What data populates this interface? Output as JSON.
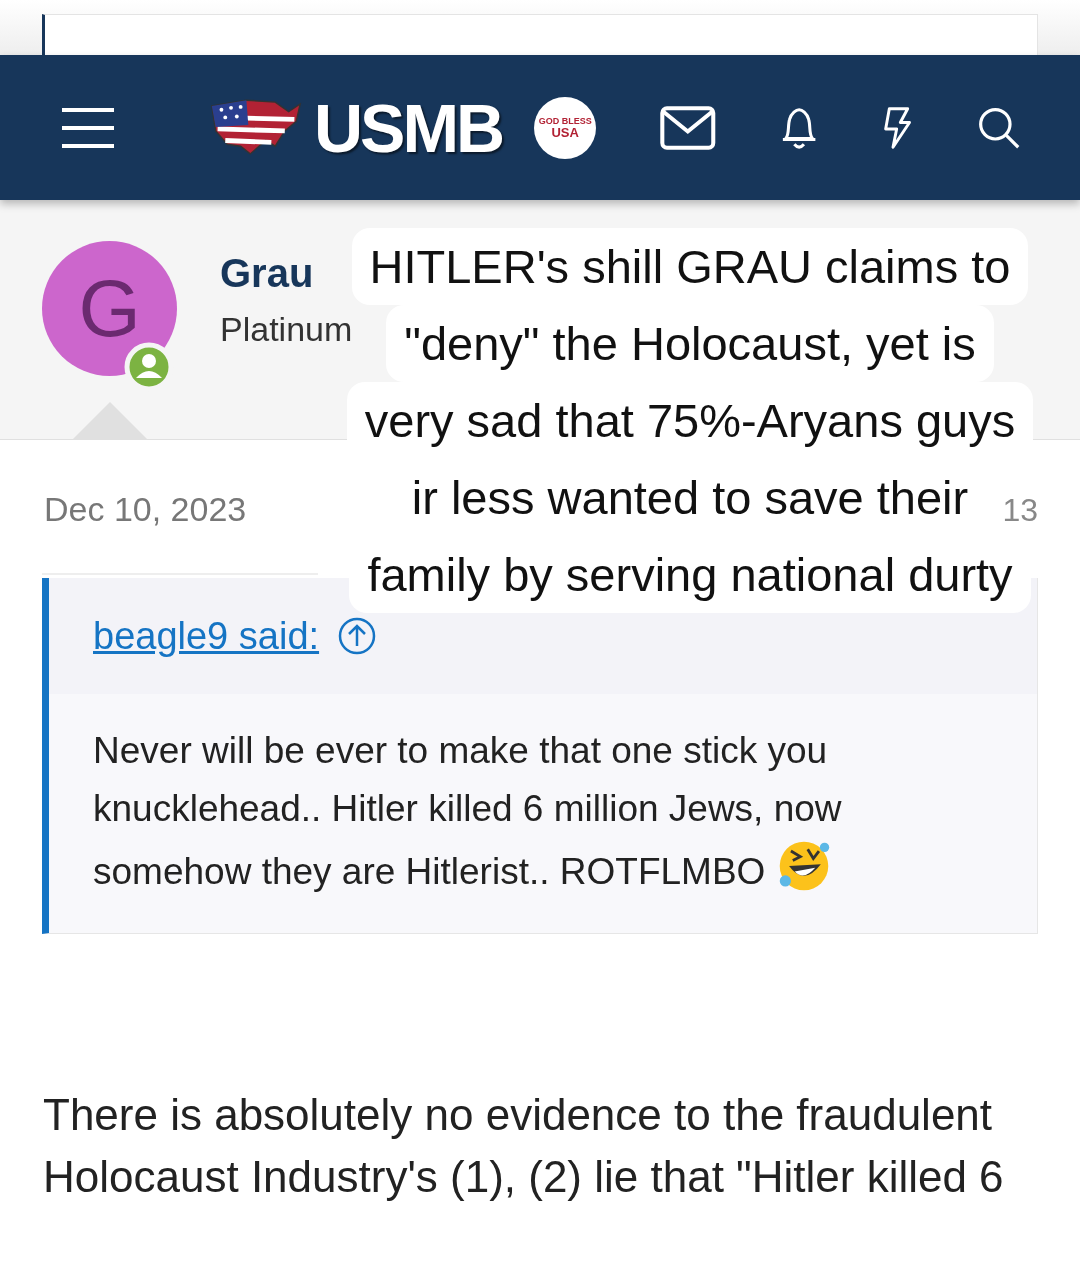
{
  "header": {
    "logo_text": "USMB",
    "badge_lines": [
      "GOD BLESS",
      "USA"
    ]
  },
  "post": {
    "avatar_letter": "G",
    "online": true,
    "username": "Grau",
    "user_title": "Platinum",
    "date": "Dec 10, 2023",
    "post_number": "13",
    "quote": {
      "author": "beagle9 said:",
      "text": "Never will be ever to make that one stick you knucklehead.. Hitler killed 6 million Jews, now somehow they are Hitlerist.. ROTFLMBO"
    },
    "body_lines": [
      "There is absolutely no evidence to the fraudulent",
      "Holocaust Industry's (1), (2) lie that \"Hitler killed 6"
    ]
  },
  "caption_lines": [
    "HITLER's shill GRAU claims to",
    "\"deny\" the Holocaust, yet is",
    "very sad that 75%-Aryans guys",
    "ir less wanted to save their",
    "family by serving national durty"
  ]
}
